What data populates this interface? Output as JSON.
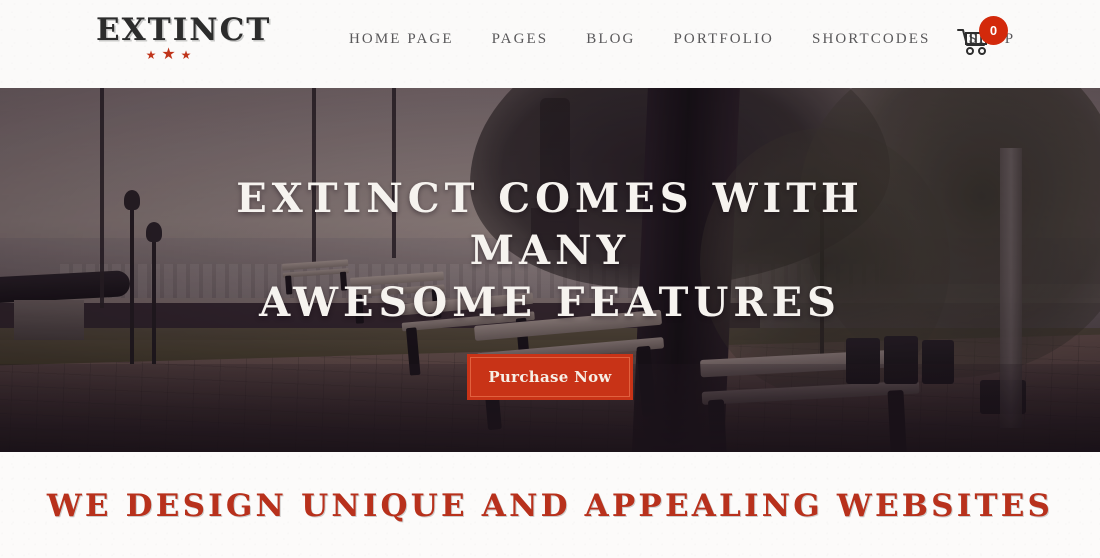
{
  "header": {
    "logo": {
      "word": "EXTINCT",
      "stars": "★ ★ ★",
      "star_color": "#c0341a"
    },
    "nav": [
      {
        "label": "HOME PAGE",
        "name": "nav-item-home-page"
      },
      {
        "label": "PAGES",
        "name": "nav-item-pages"
      },
      {
        "label": "BLOG",
        "name": "nav-item-blog"
      },
      {
        "label": "PORTFOLIO",
        "name": "nav-item-portfolio"
      },
      {
        "label": "SHORTCODES",
        "name": "nav-item-shortcodes"
      },
      {
        "label": "SHOP",
        "name": "nav-item-shop"
      }
    ],
    "cart": {
      "icon": "shopping-cart-icon",
      "badge_count": "0",
      "badge_color": "#d3290b"
    },
    "background_color": "#fbfaf9"
  },
  "hero": {
    "title": "EXTINCT COMES WITH MANY AWESOME FEATURES",
    "title_line_1": "EXTINCT COMES WITH MANY",
    "title_line_2": "AWESOME FEATURES",
    "cta_label": "Purchase Now",
    "cta_color": "#c83317",
    "cta_border_color": "#e2613f",
    "title_color": "#f6f3ef",
    "image_description": "park walkway with benches, trees, lamp posts and a cannon overlooking a harbour, sepia-purple toned"
  },
  "features": {
    "heading": "WE DESIGN UNIQUE AND APPEALING WEBSITES",
    "heading_color": "#b8311c",
    "background_color": "#fcfbfa"
  }
}
